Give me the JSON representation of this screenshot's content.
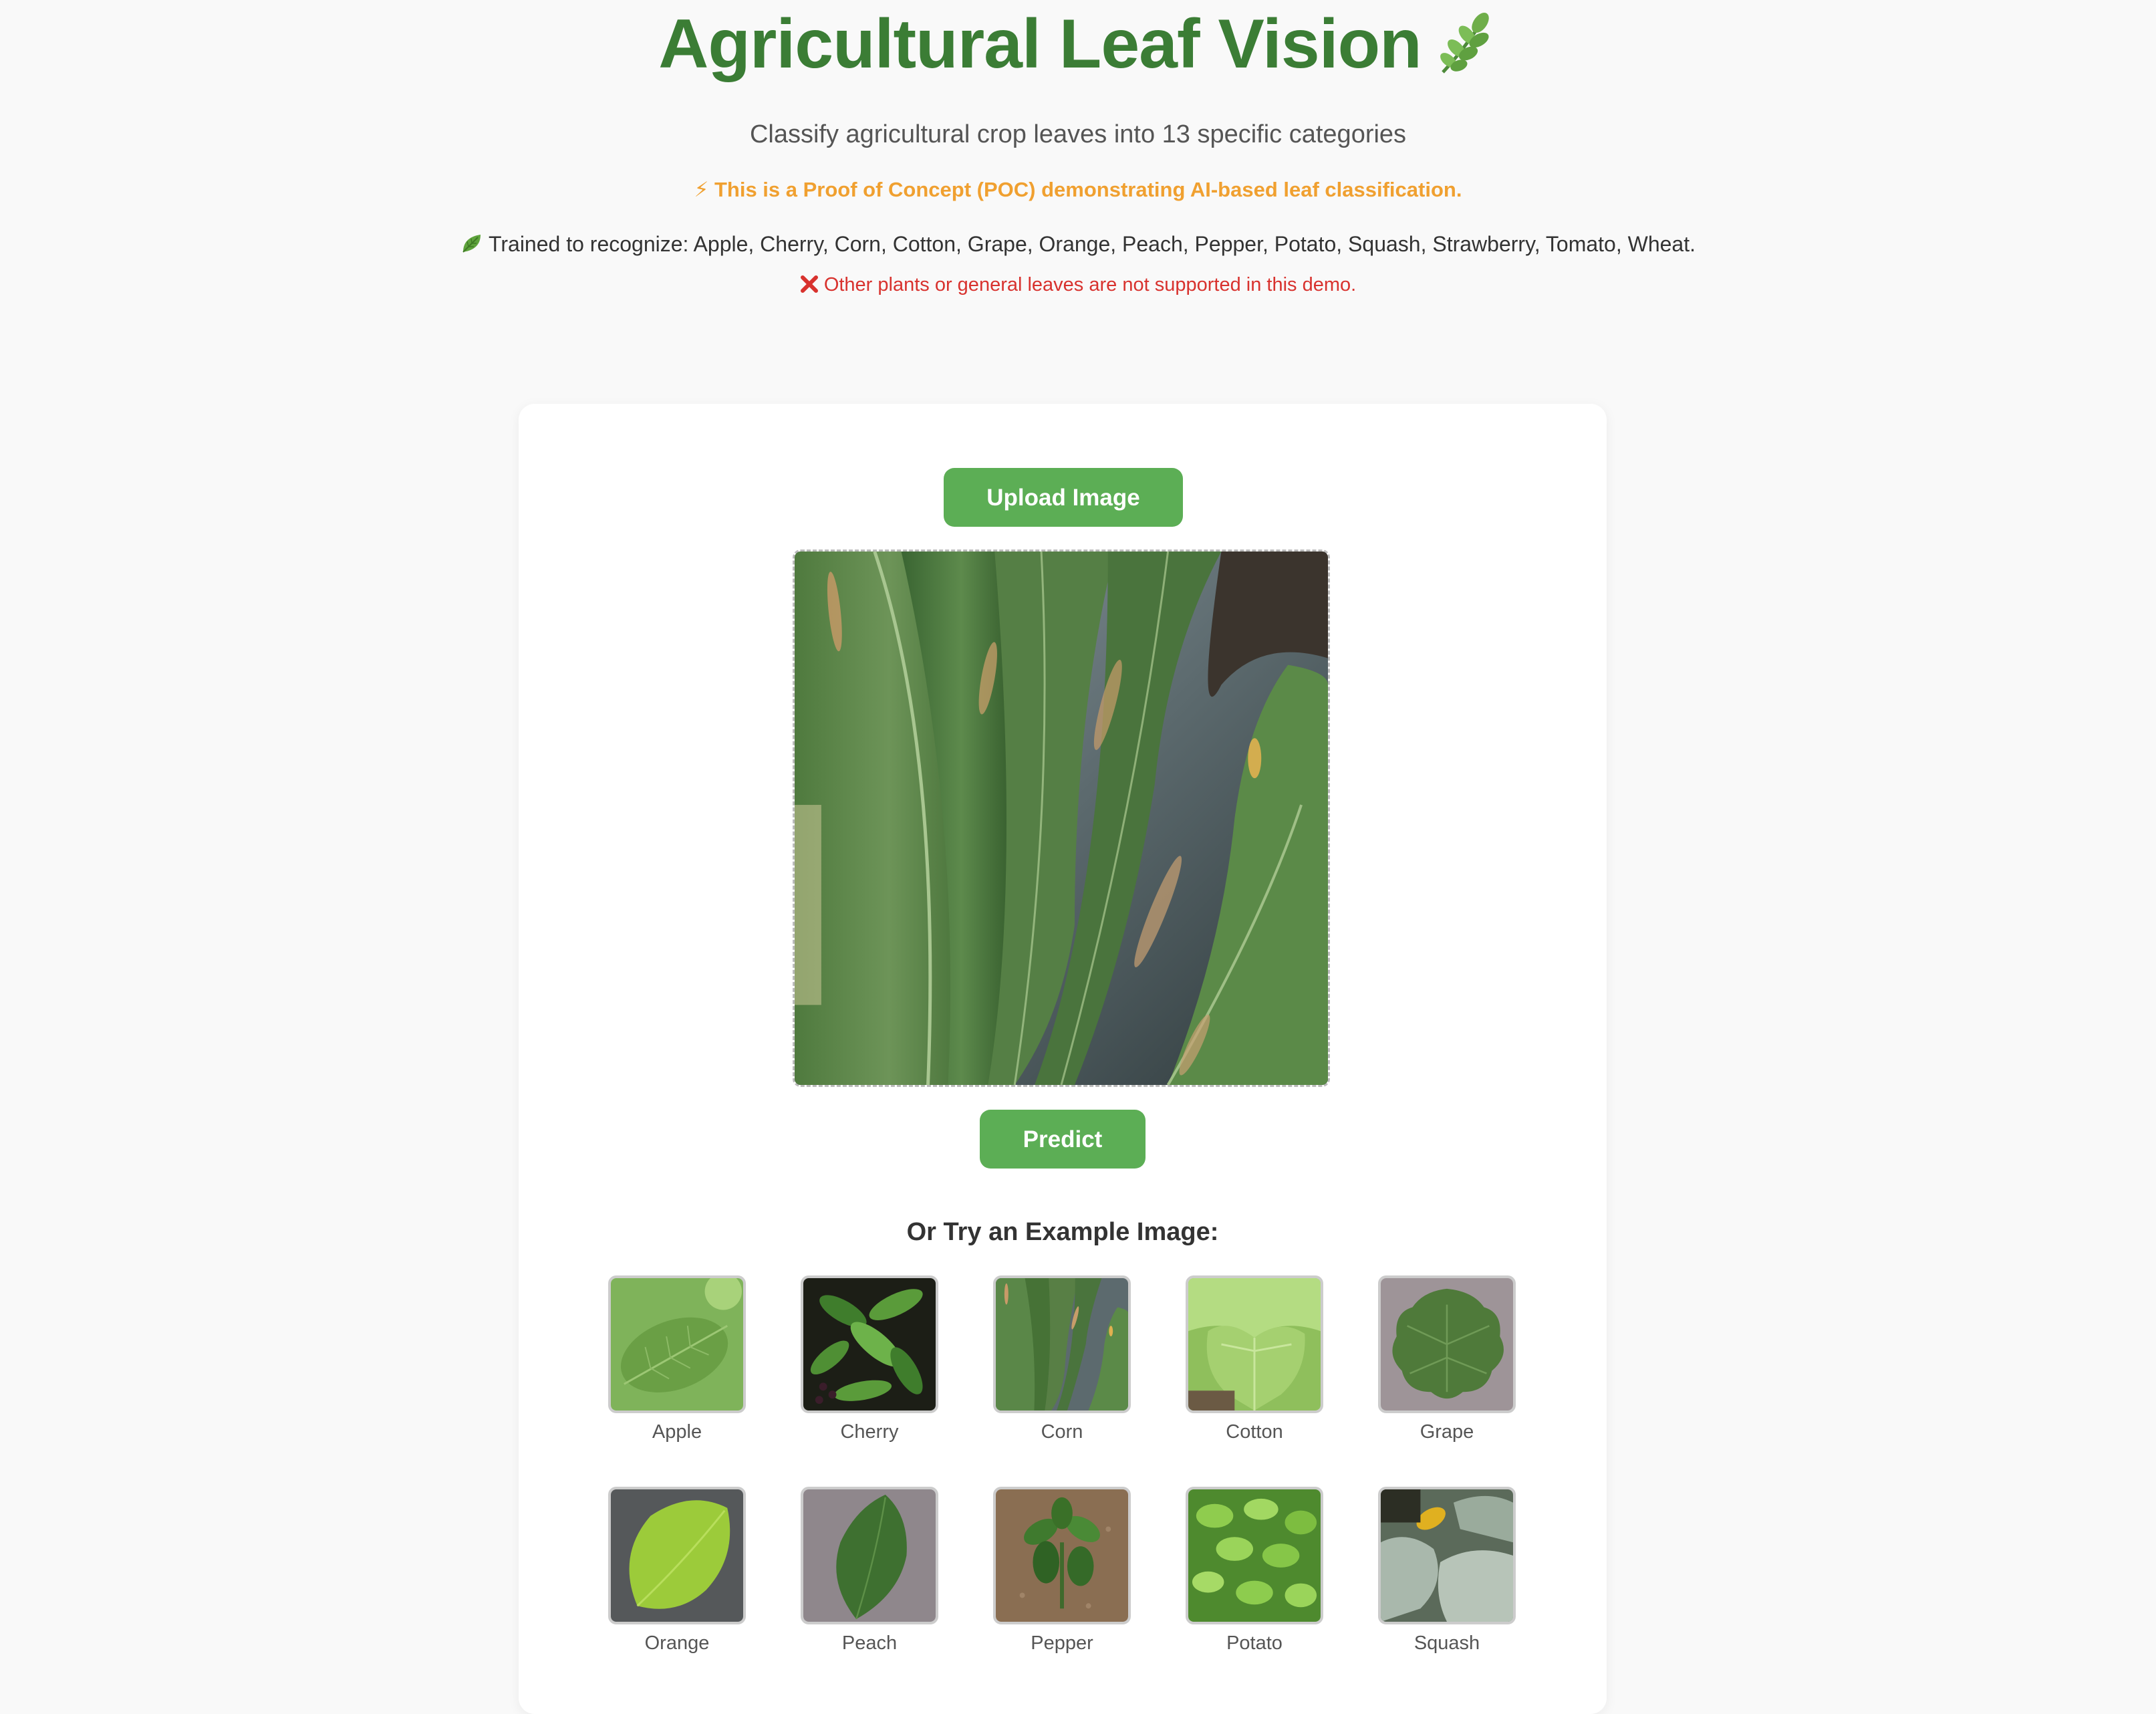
{
  "header": {
    "title": "Agricultural Leaf Vision",
    "subtitle": "Classify agricultural crop leaves into 13 specific categories",
    "poc_icon": "⚡",
    "poc_text": "This is a Proof of Concept (POC) demonstrating AI-based leaf classification.",
    "trained_text": "Trained to recognize: Apple, Cherry, Corn, Cotton, Grape, Orange, Peach, Pepper, Potato, Squash, Strawberry, Tomato, Wheat.",
    "warning_text": "Other plants or general leaves are not supported in this demo."
  },
  "card": {
    "upload_label": "Upload Image",
    "predict_label": "Predict",
    "examples_title": "Or Try an Example Image:",
    "examples": [
      {
        "label": "Apple"
      },
      {
        "label": "Cherry"
      },
      {
        "label": "Corn"
      },
      {
        "label": "Cotton"
      },
      {
        "label": "Grape"
      },
      {
        "label": "Orange"
      },
      {
        "label": "Peach"
      },
      {
        "label": "Pepper"
      },
      {
        "label": "Potato"
      },
      {
        "label": "Squash"
      }
    ]
  },
  "colors": {
    "title": "#3b7d35",
    "button": "#5cae55",
    "poc": "#f0a030",
    "warning": "#d8322e",
    "background": "#f9f9f9"
  },
  "icons": {
    "title_icon": "herb-leaf-icon",
    "trained_icon": "leafy-green-icon",
    "warning_icon": "cross-mark-icon"
  }
}
